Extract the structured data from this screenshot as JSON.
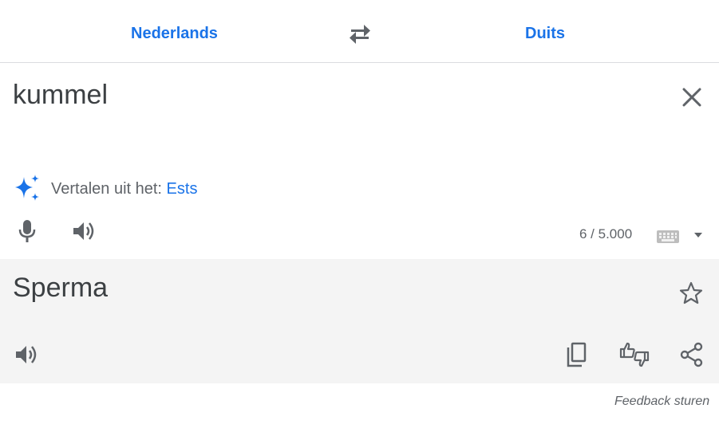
{
  "languages": {
    "source": "Nederlands",
    "target": "Duits"
  },
  "source": {
    "text": "kummel",
    "char_count": "6 / 5.000"
  },
  "detect": {
    "label": "Vertalen uit het:",
    "language": "Ests"
  },
  "result": {
    "text": "Sperma"
  },
  "footer": {
    "feedback": "Feedback sturen"
  },
  "icons": {
    "swap": "swap-icon",
    "clear": "close-icon",
    "sparkle": "sparkle-icon",
    "mic": "mic-icon",
    "speaker": "speaker-icon",
    "keyboard": "keyboard-icon",
    "dropdown": "dropdown-arrow-icon",
    "star": "star-icon",
    "copy": "copy-icon",
    "rate": "thumbs-icon",
    "share": "share-icon"
  },
  "colors": {
    "accent": "#1a73e8",
    "text": "#3c4043",
    "muted": "#5f6368",
    "result_bg": "#f4f4f4",
    "icon": "#5f6368"
  }
}
